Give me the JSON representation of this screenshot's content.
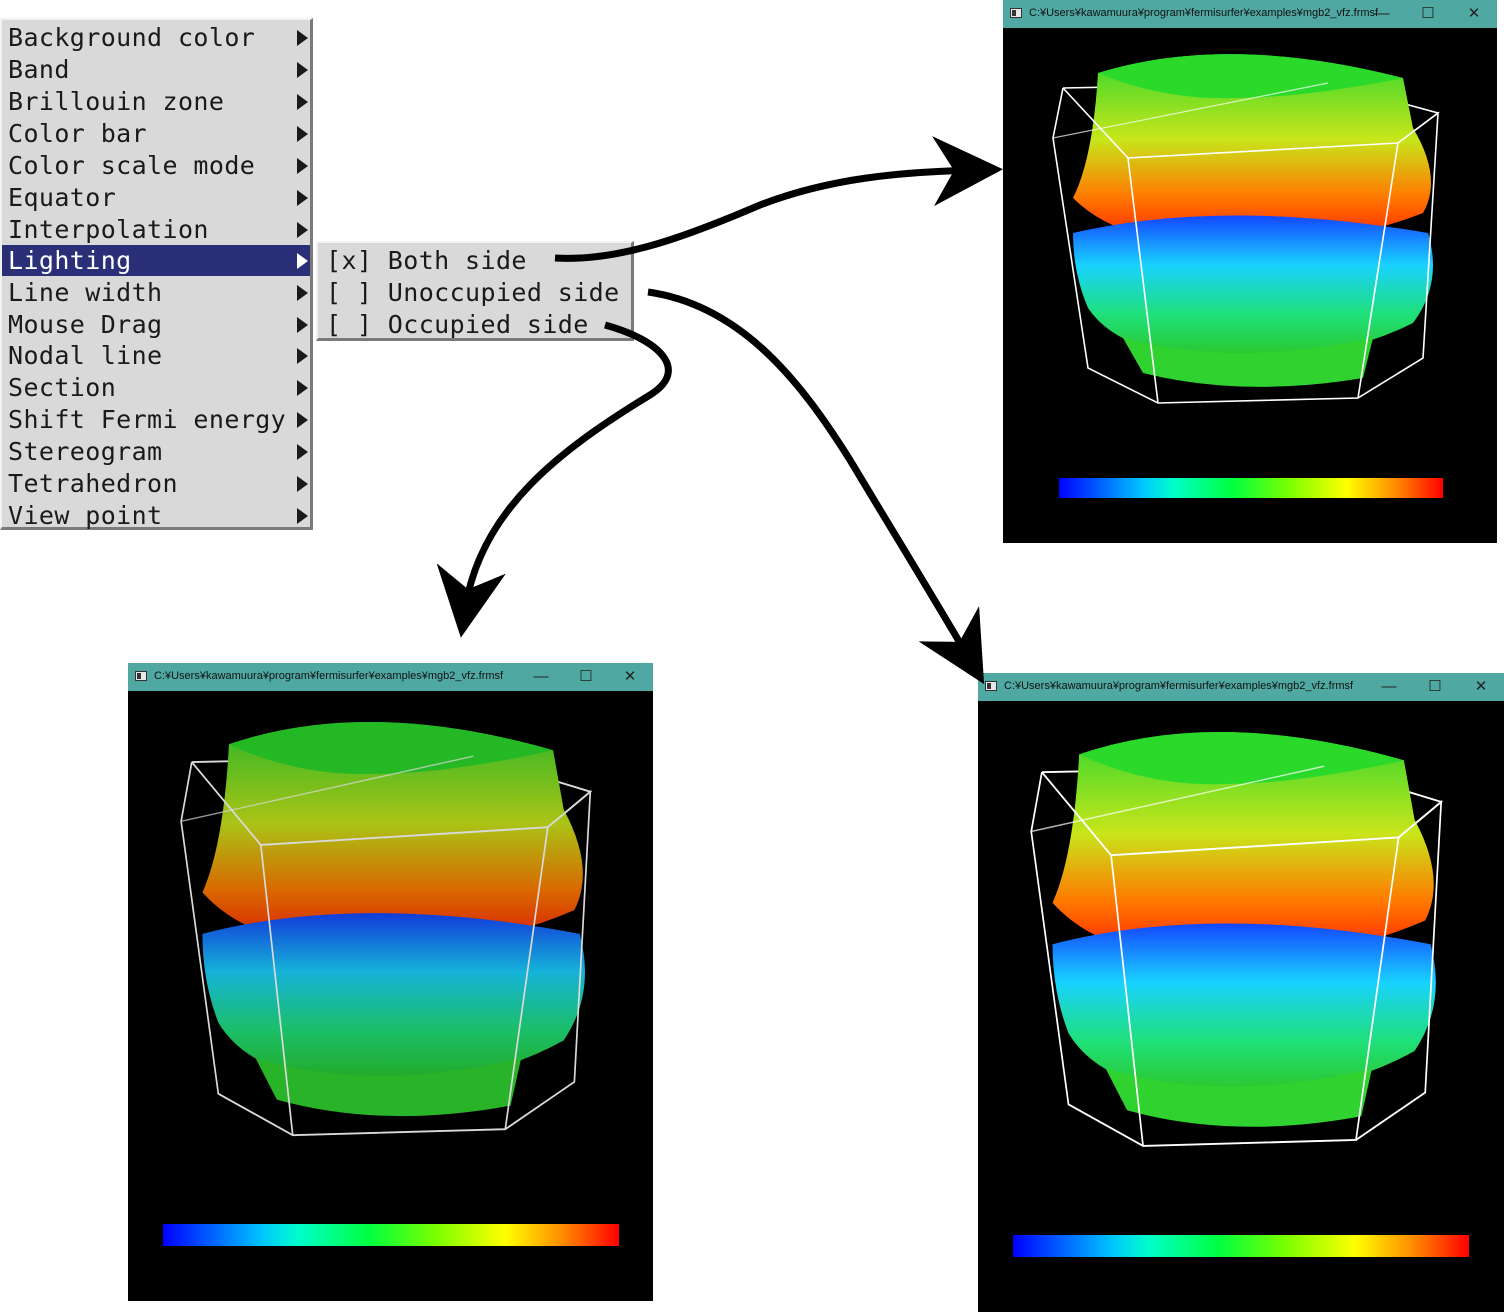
{
  "menu": {
    "items": [
      {
        "label": "Background color"
      },
      {
        "label": "Band"
      },
      {
        "label": "Brillouin zone"
      },
      {
        "label": "Color bar"
      },
      {
        "label": "Color scale mode"
      },
      {
        "label": "Equator"
      },
      {
        "label": "Interpolation"
      },
      {
        "label": "Lighting"
      },
      {
        "label": "Line width"
      },
      {
        "label": "Mouse Drag"
      },
      {
        "label": "Nodal line"
      },
      {
        "label": "Section"
      },
      {
        "label": "Shift Fermi energy"
      },
      {
        "label": "Stereogram"
      },
      {
        "label": "Tetrahedron"
      },
      {
        "label": "View point"
      }
    ],
    "selected_index": 7
  },
  "submenu": {
    "items": [
      {
        "label": "[x] Both side"
      },
      {
        "label": "[ ] Unoccupied side"
      },
      {
        "label": "[ ] Occupied side"
      }
    ]
  },
  "window": {
    "title": "C:¥Users¥kawamuura¥program¥fermisurfer¥examples¥mgb2_vfz.frmsf",
    "minimize_glyph": "—",
    "maximize_glyph": "☐",
    "close_glyph": "✕"
  },
  "colors": {
    "menu_highlight": "#2a2f78",
    "titlebar": "#4fa9a2"
  }
}
